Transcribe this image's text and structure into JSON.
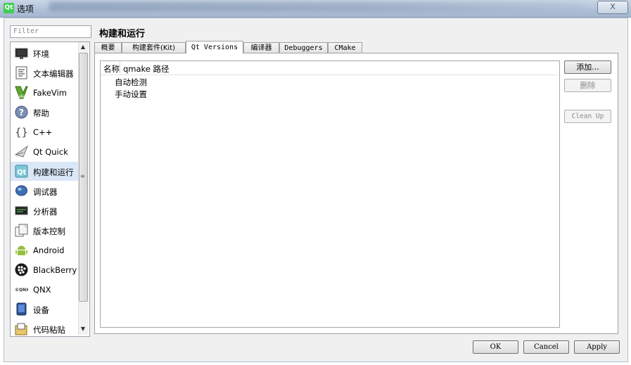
{
  "window": {
    "title": "选项",
    "app_icon": "Qt",
    "close_symbol": "X"
  },
  "sidebar": {
    "filter_placeholder": "Filter",
    "items": [
      {
        "label": "环境",
        "icon": "monitor-icon"
      },
      {
        "label": "文本编辑器",
        "icon": "text-editor-icon"
      },
      {
        "label": "FakeVim",
        "icon": "fakevim-icon"
      },
      {
        "label": "帮助",
        "icon": "help-icon"
      },
      {
        "label": "C++",
        "icon": "cpp-braces-icon"
      },
      {
        "label": "Qt Quick",
        "icon": "qt-quick-icon"
      },
      {
        "label": "构建和运行",
        "icon": "build-run-icon"
      },
      {
        "label": "调试器",
        "icon": "debugger-icon"
      },
      {
        "label": "分析器",
        "icon": "analyzer-icon"
      },
      {
        "label": "版本控制",
        "icon": "version-control-icon"
      },
      {
        "label": "Android",
        "icon": "android-icon"
      },
      {
        "label": "BlackBerry",
        "icon": "blackberry-icon"
      },
      {
        "label": "QNX",
        "icon": "qnx-icon"
      },
      {
        "label": "设备",
        "icon": "device-icon"
      },
      {
        "label": "代码粘贴",
        "icon": "code-paste-icon"
      }
    ],
    "selected_index": 6
  },
  "page": {
    "title": "构建和运行",
    "tabs": [
      "概要",
      "构建套件(Kit)",
      "Qt Versions",
      "编译器",
      "Debuggers",
      "CMake"
    ],
    "active_tab": "Qt Versions"
  },
  "qt_versions": {
    "columns": [
      "名称",
      "qmake 路径"
    ],
    "groups": [
      "自动检测",
      "手动设置"
    ],
    "buttons": {
      "add": "添加...",
      "remove": "删除",
      "cleanup": "Clean Up"
    }
  },
  "dialog_buttons": {
    "ok": "OK",
    "cancel": "Cancel",
    "apply": "Apply"
  },
  "colors": {
    "selection": "#d9e7f7",
    "qt_green": "#41cd52"
  }
}
